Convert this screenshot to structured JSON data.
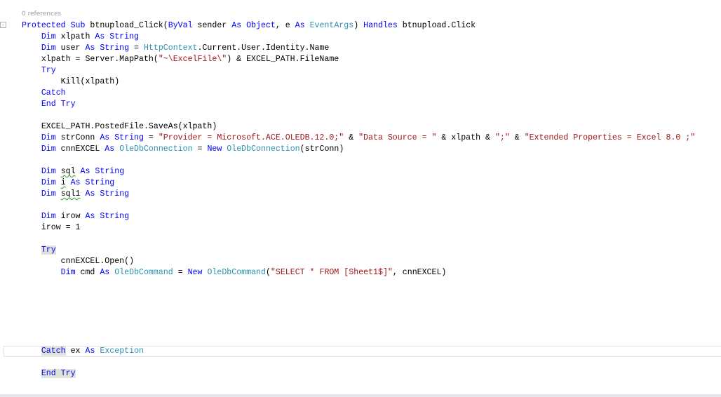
{
  "editor": {
    "codelens": "0 references",
    "collapse_glyph": "-",
    "colors": {
      "keyword": "#0000ff",
      "type": "#2b91af",
      "string": "#a31515",
      "highlight": "#dfe2d6"
    },
    "current_line_index": 29,
    "lines": [
      {
        "indent": 0,
        "tokens": [
          [
            "k",
            "Protected Sub"
          ],
          [
            "p",
            " btnupload_Click("
          ],
          [
            "k",
            "ByVal"
          ],
          [
            "p",
            " sender "
          ],
          [
            "k",
            "As Object"
          ],
          [
            "p",
            ", e "
          ],
          [
            "k",
            "As"
          ],
          [
            "p",
            " "
          ],
          [
            "t",
            "EventArgs"
          ],
          [
            "p",
            ") "
          ],
          [
            "k",
            "Handles"
          ],
          [
            "p",
            " btnupload.Click"
          ]
        ]
      },
      {
        "indent": 1,
        "tokens": [
          [
            "k",
            "Dim"
          ],
          [
            "p",
            " xlpath "
          ],
          [
            "k",
            "As String"
          ]
        ]
      },
      {
        "indent": 1,
        "tokens": [
          [
            "k",
            "Dim"
          ],
          [
            "p",
            " user "
          ],
          [
            "k",
            "As String"
          ],
          [
            "p",
            " = "
          ],
          [
            "t",
            "HttpContext"
          ],
          [
            "p",
            ".Current.User.Identity.Name"
          ]
        ]
      },
      {
        "indent": 1,
        "tokens": [
          [
            "p",
            "xlpath = Server.MapPath("
          ],
          [
            "s",
            "\"~\\ExcelFile\\\""
          ],
          [
            "p",
            ") & EXCEL_PATH.FileName"
          ]
        ]
      },
      {
        "indent": 1,
        "tokens": [
          [
            "k",
            "Try"
          ]
        ]
      },
      {
        "indent": 2,
        "tokens": [
          [
            "p",
            "Kill(xlpath)"
          ]
        ]
      },
      {
        "indent": 1,
        "tokens": [
          [
            "k",
            "Catch"
          ]
        ]
      },
      {
        "indent": 1,
        "tokens": [
          [
            "k",
            "End Try"
          ]
        ]
      },
      {
        "indent": 0,
        "tokens": []
      },
      {
        "indent": 1,
        "tokens": [
          [
            "p",
            "EXCEL_PATH.PostedFile.SaveAs(xlpath)"
          ]
        ]
      },
      {
        "indent": 1,
        "tokens": [
          [
            "k",
            "Dim"
          ],
          [
            "p",
            " strConn "
          ],
          [
            "k",
            "As String"
          ],
          [
            "p",
            " = "
          ],
          [
            "s",
            "\"Provider = Microsoft.ACE.OLEDB.12.0;\""
          ],
          [
            "p",
            " & "
          ],
          [
            "s",
            "\"Data Source = \""
          ],
          [
            "p",
            " & xlpath & "
          ],
          [
            "s",
            "\";\""
          ],
          [
            "p",
            " & "
          ],
          [
            "s",
            "\"Extended Properties = Excel 8.0 ;\""
          ]
        ]
      },
      {
        "indent": 1,
        "tokens": [
          [
            "k",
            "Dim"
          ],
          [
            "p",
            " cnnEXCEL "
          ],
          [
            "k",
            "As"
          ],
          [
            "p",
            " "
          ],
          [
            "t",
            "OleDbConnection"
          ],
          [
            "p",
            " = "
          ],
          [
            "k",
            "New"
          ],
          [
            "p",
            " "
          ],
          [
            "t",
            "OleDbConnection"
          ],
          [
            "p",
            "(strConn)"
          ]
        ]
      },
      {
        "indent": 0,
        "tokens": []
      },
      {
        "indent": 1,
        "tokens": [
          [
            "k",
            "Dim"
          ],
          [
            "p",
            " "
          ],
          [
            "sq",
            "sql"
          ],
          [
            "p",
            " "
          ],
          [
            "k",
            "As String"
          ]
        ]
      },
      {
        "indent": 1,
        "tokens": [
          [
            "k",
            "Dim"
          ],
          [
            "p",
            " "
          ],
          [
            "sq",
            "i"
          ],
          [
            "p",
            " "
          ],
          [
            "k",
            "As String"
          ]
        ]
      },
      {
        "indent": 1,
        "tokens": [
          [
            "k",
            "Dim"
          ],
          [
            "p",
            " "
          ],
          [
            "sq",
            "sql1"
          ],
          [
            "p",
            " "
          ],
          [
            "k",
            "As String"
          ]
        ]
      },
      {
        "indent": 0,
        "tokens": []
      },
      {
        "indent": 1,
        "tokens": [
          [
            "k",
            "Dim"
          ],
          [
            "p",
            " irow "
          ],
          [
            "k",
            "As String"
          ]
        ]
      },
      {
        "indent": 1,
        "tokens": [
          [
            "p",
            "irow = 1"
          ]
        ]
      },
      {
        "indent": 0,
        "tokens": []
      },
      {
        "indent": 1,
        "tokens": [
          [
            "khl",
            "Try"
          ]
        ]
      },
      {
        "indent": 2,
        "tokens": [
          [
            "p",
            "cnnEXCEL.Open()"
          ]
        ]
      },
      {
        "indent": 2,
        "tokens": [
          [
            "k",
            "Dim"
          ],
          [
            "p",
            " cmd "
          ],
          [
            "k",
            "As"
          ],
          [
            "p",
            " "
          ],
          [
            "t",
            "OleDbCommand"
          ],
          [
            "p",
            " = "
          ],
          [
            "k",
            "New"
          ],
          [
            "p",
            " "
          ],
          [
            "t",
            "OleDbCommand"
          ],
          [
            "p",
            "("
          ],
          [
            "s",
            "\"SELECT * FROM [Sheet1$]\""
          ],
          [
            "p",
            ", cnnEXCEL)"
          ]
        ]
      },
      {
        "indent": 0,
        "tokens": []
      },
      {
        "indent": 0,
        "tokens": []
      },
      {
        "indent": 0,
        "tokens": []
      },
      {
        "indent": 0,
        "tokens": []
      },
      {
        "indent": 0,
        "tokens": []
      },
      {
        "indent": 0,
        "tokens": []
      },
      {
        "indent": 1,
        "tokens": [
          [
            "khl",
            "Catch"
          ],
          [
            "p",
            " ex "
          ],
          [
            "k",
            "As"
          ],
          [
            "p",
            " "
          ],
          [
            "t",
            "Exception"
          ]
        ]
      },
      {
        "indent": 0,
        "tokens": []
      },
      {
        "indent": 1,
        "tokens": [
          [
            "khl",
            "End Try"
          ]
        ]
      }
    ]
  }
}
